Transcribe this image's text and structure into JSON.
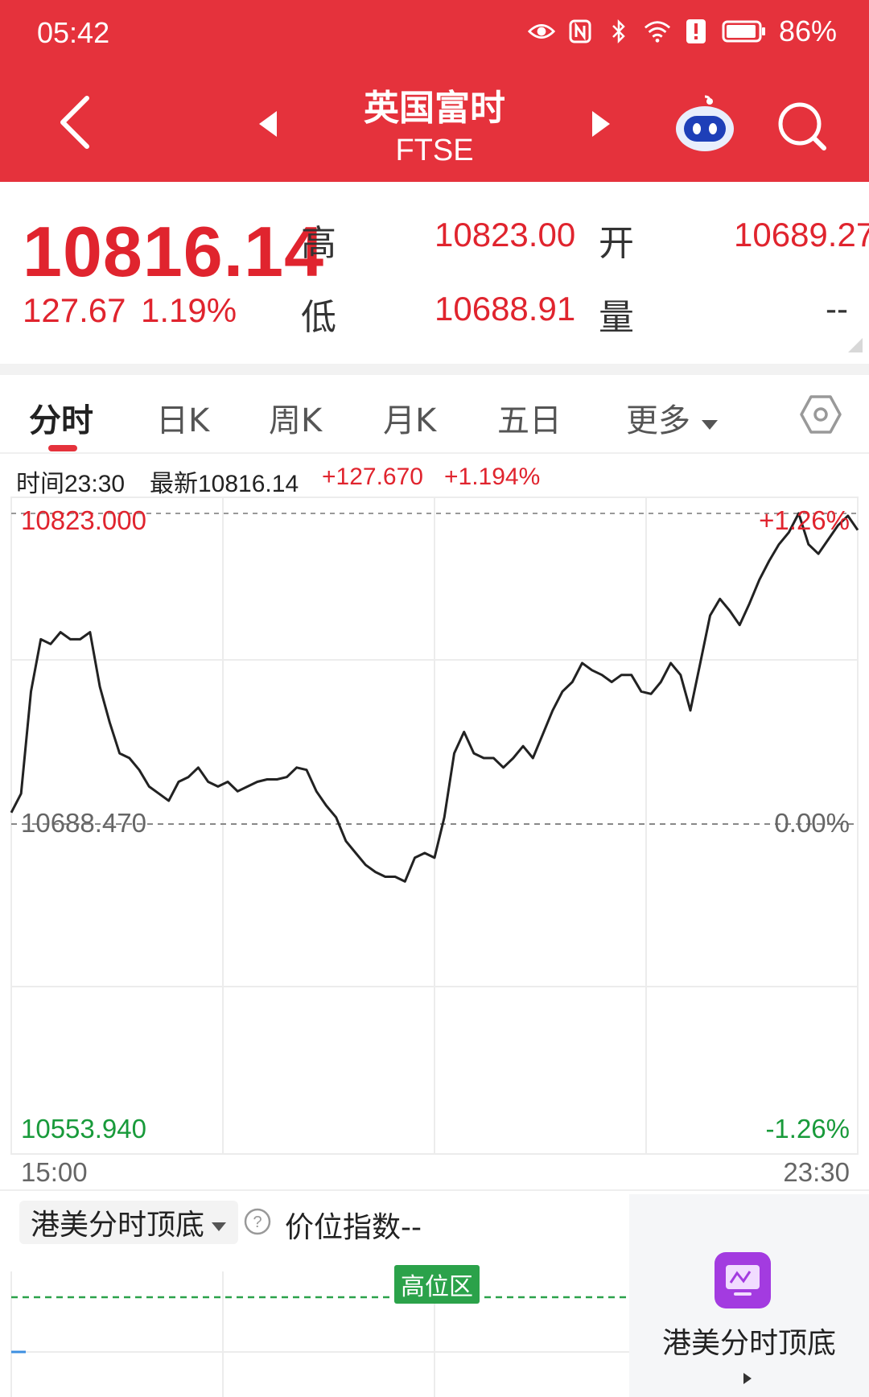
{
  "status_bar": {
    "time": "05:42",
    "battery": "86%"
  },
  "nav": {
    "title": "英国富时",
    "subtitle": "FTSE"
  },
  "quote": {
    "price": "10816.14",
    "change": "127.67",
    "change_pct": "1.19%",
    "high_label": "高",
    "high_value": "10823.00",
    "open_label": "开",
    "open_value": "10689.27",
    "low_label": "低",
    "low_value": "10688.91",
    "volume_label": "量",
    "volume_value": "--"
  },
  "tabs": [
    {
      "label": "分时",
      "active": true
    },
    {
      "label": "日K"
    },
    {
      "label": "周K"
    },
    {
      "label": "月K"
    },
    {
      "label": "五日"
    },
    {
      "label": "更多"
    }
  ],
  "info_line": {
    "time": "时间23:30",
    "latest": "最新10816.14",
    "change": "+127.670",
    "change_pct": "+1.194%"
  },
  "chart_data": {
    "type": "line",
    "y_max_label": "10823.000",
    "y_mid_label": "10688.470",
    "y_min_label": "10553.940",
    "pct_max_label": "+1.26%",
    "pct_mid_label": "0.00%",
    "pct_min_label": "-1.26%",
    "x_start_label": "15:00",
    "x_end_label": "23:30",
    "ylim": [
      10553.94,
      10823.0
    ],
    "baseline": 10688.47,
    "x_range": [
      "15:00",
      "23:30"
    ],
    "values": [
      10697,
      10705,
      10748,
      10770,
      10768,
      10773,
      10770,
      10770,
      10773,
      10750,
      10735,
      10722,
      10720,
      10715,
      10708,
      10705,
      10702,
      10710,
      10712,
      10716,
      10710,
      10708,
      10710,
      10706,
      10708,
      10710,
      10711,
      10711,
      10712,
      10716,
      10715,
      10706,
      10700,
      10695,
      10685,
      10680,
      10675,
      10672,
      10670,
      10670,
      10668,
      10678,
      10680,
      10678,
      10695,
      10722,
      10731,
      10722,
      10720,
      10720,
      10716,
      10720,
      10725,
      10720,
      10730,
      10740,
      10748,
      10752,
      10760,
      10757,
      10755,
      10752,
      10755,
      10755,
      10748,
      10747,
      10752,
      10760,
      10755,
      10740,
      10760,
      10780,
      10787,
      10782,
      10776,
      10785,
      10795,
      10803,
      10810,
      10815,
      10823,
      10810,
      10806,
      10812,
      10818,
      10822,
      10816
    ],
    "grid": true,
    "series_color": "#222222"
  },
  "indicator": {
    "name": "港美分时顶底",
    "price_index": "价位指数--",
    "zone_label": "高位区",
    "panel_label": "港美分时顶底"
  },
  "colors": {
    "header": "#e5323c",
    "up": "#e0242e",
    "down": "#189a3a"
  }
}
